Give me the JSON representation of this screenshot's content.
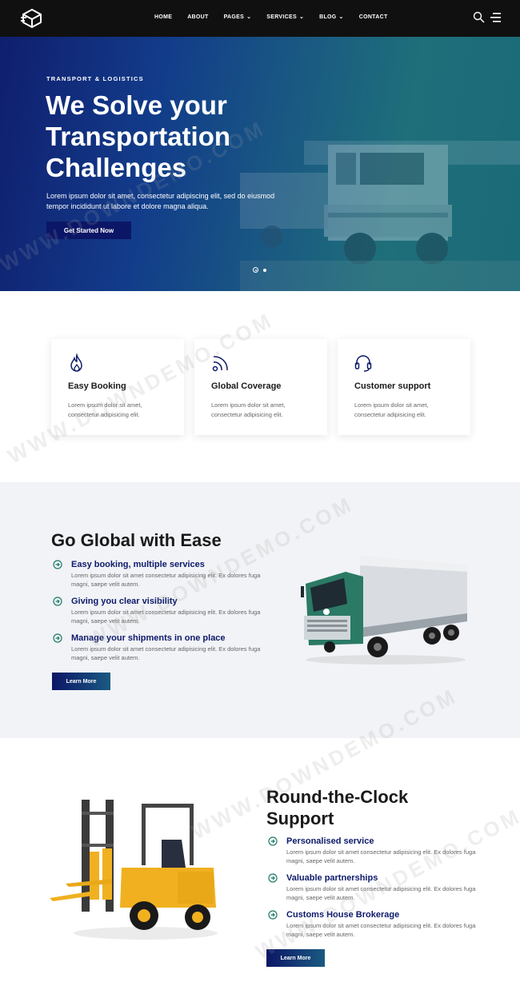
{
  "nav": {
    "items": [
      {
        "label": "HOME",
        "dropdown": false
      },
      {
        "label": "ABOUT",
        "dropdown": false
      },
      {
        "label": "PAGES",
        "dropdown": true
      },
      {
        "label": "SERVICES",
        "dropdown": true
      },
      {
        "label": "BLOG",
        "dropdown": true
      },
      {
        "label": "CONTACT",
        "dropdown": false
      }
    ],
    "chevron": "⌄"
  },
  "hero": {
    "kicker": "TRANSPORT & LOGISTICS",
    "title": "We Solve your Transportation Challenges",
    "description": "Lorem ipsum dolor sit amet, consectetur adipiscing elit, sed do eiusmod tempor incididunt ut labore et dolore magna aliqua.",
    "button": "Get Started Now",
    "slides_total": 2,
    "active_slide": 1
  },
  "features": [
    {
      "icon": "fire-icon",
      "title": "Easy Booking",
      "text": "Lorem ipsum dolor sit amet, consectetur adipisicing elit."
    },
    {
      "icon": "signal-icon",
      "title": "Global Coverage",
      "text": "Lorem ipsum dolor sit amet, consectetur adipisicing elit."
    },
    {
      "icon": "headset-icon",
      "title": "Customer support",
      "text": "Lorem ipsum dolor sit amet, consectetur adipisicing elit."
    }
  ],
  "global": {
    "title": "Go Global with Ease",
    "items": [
      {
        "title": "Easy booking, multiple services",
        "text": "Lorem ipsum dolor sit amet consectetur adipisicing elit. Ex dolores fuga magni, saepe velit autem."
      },
      {
        "title": "Giving you clear visibility",
        "text": "Lorem ipsum dolor sit amet consectetur adipisicing elit. Ex dolores fuga magni, saepe velit autem."
      },
      {
        "title": "Manage your shipments in one place",
        "text": "Lorem ipsum dolor sit amet consectetur adipisicing elit. Ex dolores fuga magni, saepe velit autem."
      }
    ],
    "button": "Learn More"
  },
  "support": {
    "title": "Round-the-Clock Support",
    "items": [
      {
        "title": "Personalised service",
        "text": "Lorem ipsum dolor sit amet consectetur adipisicing elit. Ex dolores fuga magni, saepe velit autem."
      },
      {
        "title": "Valuable partnerships",
        "text": "Lorem ipsum dolor sit amet consectetur adipisicing elit. Ex dolores fuga magni, saepe velit autem."
      },
      {
        "title": "Customs House Brokerage",
        "text": "Lorem ipsum dolor sit amet consectetur adipisicing elit. Ex dolores fuga magni, saepe velit autem."
      }
    ],
    "button": "Learn More"
  },
  "watermark": "WWW.DOWNDEMO.COM",
  "colors": {
    "nav_bg": "#101010",
    "primary": "#0c1666",
    "accent_teal": "#1e6f7a",
    "check_green": "#1e7a6a",
    "card_icon": "#0d1a6a"
  }
}
